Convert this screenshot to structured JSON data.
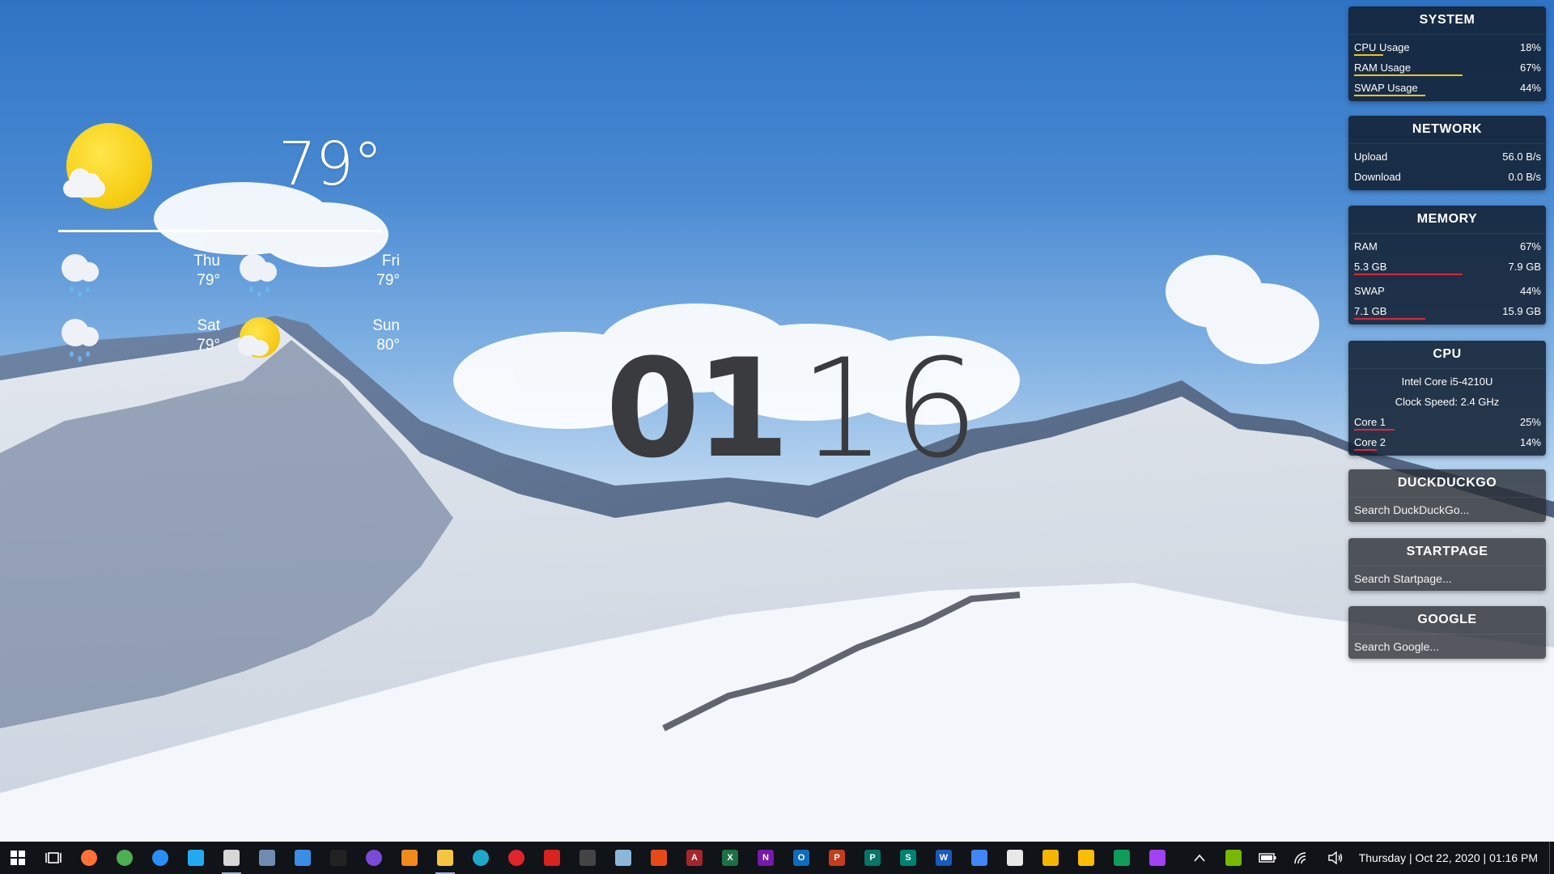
{
  "weather": {
    "current_temp": "79°",
    "current_icon": "sun-cloud-icon",
    "forecast": [
      {
        "day": "Thu",
        "temp": "79°",
        "icon": "rain-cloud-icon"
      },
      {
        "day": "Fri",
        "temp": "79°",
        "icon": "rain-cloud-icon"
      },
      {
        "day": "Sat",
        "temp": "79°",
        "icon": "rain-cloud-icon"
      },
      {
        "day": "Sun",
        "temp": "80°",
        "icon": "sun-cloud-icon"
      }
    ]
  },
  "clock": {
    "hours": "01",
    "minutes": "16"
  },
  "system": {
    "title": "SYSTEM",
    "rows": [
      {
        "label": "CPU Usage",
        "value": "18%",
        "level": 0.18
      },
      {
        "label": "RAM Usage",
        "value": "67%",
        "level": 0.67
      },
      {
        "label": "SWAP Usage",
        "value": "44%",
        "level": 0.44
      }
    ],
    "bar_color": "#f0c419"
  },
  "network": {
    "title": "NETWORK",
    "rows": [
      {
        "label": "Upload",
        "value": "56.0 B/s"
      },
      {
        "label": "Download",
        "value": "0.0 B/s"
      }
    ]
  },
  "memory": {
    "title": "MEMORY",
    "ram_label": "RAM",
    "ram_percent": "67%",
    "ram_used": "5.3 GB",
    "ram_total": "7.9 GB",
    "ram_level": 0.67,
    "swap_label": "SWAP",
    "swap_percent": "44%",
    "swap_used": "7.1 GB",
    "swap_total": "15.9 GB",
    "swap_level": 0.44,
    "bar_color": "#d8293a"
  },
  "cpu": {
    "title": "CPU",
    "model": "Intel Core i5-4210U",
    "clock_speed": "Clock Speed: 2.4 GHz",
    "cores": [
      {
        "label": "Core 1",
        "value": "25%",
        "level": 0.25
      },
      {
        "label": "Core 2",
        "value": "14%",
        "level": 0.14
      }
    ],
    "bar_color": "#d8293a"
  },
  "search": [
    {
      "title": "DUCKDUCKGO",
      "placeholder": "Search DuckDuckGo..."
    },
    {
      "title": "STARTPAGE",
      "placeholder": "Search Startpage..."
    },
    {
      "title": "GOOGLE",
      "placeholder": "Search Google..."
    }
  ],
  "taskbar": {
    "apps": [
      {
        "name": "firefox-icon",
        "glyph": "",
        "color": "#ff7139"
      },
      {
        "name": "chrome-icon",
        "glyph": "",
        "color": "#4caf50"
      },
      {
        "name": "firefox-dev-icon",
        "glyph": "",
        "color": "#2a8ef5"
      },
      {
        "name": "vscode-icon",
        "glyph": "",
        "color": "#23a9f2"
      },
      {
        "name": "notepad-icon",
        "glyph": "",
        "color": "#d7d7d7"
      },
      {
        "name": "calculator-icon",
        "glyph": "",
        "color": "#6f8bb0"
      },
      {
        "name": "remote-desktop-icon",
        "glyph": "",
        "color": "#3a8ee6"
      },
      {
        "name": "terminal-icon",
        "glyph": "",
        "color": "#222"
      },
      {
        "name": "tor-icon",
        "glyph": "",
        "color": "#7b4ad6"
      },
      {
        "name": "vlc-icon",
        "glyph": "",
        "color": "#f08a1c"
      },
      {
        "name": "file-explorer-icon",
        "glyph": "",
        "color": "#f5c542"
      },
      {
        "name": "edge-icon",
        "glyph": "",
        "color": "#1fa7c9"
      },
      {
        "name": "opera-icon",
        "glyph": "",
        "color": "#e0242b"
      },
      {
        "name": "acrobat-icon",
        "glyph": "",
        "color": "#d8231f"
      },
      {
        "name": "game-controller-icon",
        "glyph": "",
        "color": "#444"
      },
      {
        "name": "settings-app-icon",
        "glyph": "",
        "color": "#8db7d9"
      },
      {
        "name": "office-icon",
        "glyph": "",
        "color": "#e64a19"
      },
      {
        "name": "access-icon",
        "glyph": "A",
        "color": "#a4262c"
      },
      {
        "name": "excel-icon",
        "glyph": "X",
        "color": "#1d7044"
      },
      {
        "name": "onenote-icon",
        "glyph": "N",
        "color": "#7719aa"
      },
      {
        "name": "outlook-icon",
        "glyph": "O",
        "color": "#0f6cbd"
      },
      {
        "name": "powerpoint-icon",
        "glyph": "P",
        "color": "#c43e1c"
      },
      {
        "name": "publisher-icon",
        "glyph": "P",
        "color": "#077568"
      },
      {
        "name": "sway-icon",
        "glyph": "S",
        "color": "#008272"
      },
      {
        "name": "word-icon",
        "glyph": "W",
        "color": "#185abd"
      },
      {
        "name": "docs-icon",
        "glyph": "",
        "color": "#4285f4"
      },
      {
        "name": "file-icon",
        "glyph": "",
        "color": "#e8e8e8"
      },
      {
        "name": "slides-icon",
        "glyph": "",
        "color": "#f4b400"
      },
      {
        "name": "keep-icon",
        "glyph": "",
        "color": "#fbbc04"
      },
      {
        "name": "sheets-icon",
        "glyph": "",
        "color": "#0f9d58"
      },
      {
        "name": "forms-icon",
        "glyph": "",
        "color": "#a142f4"
      }
    ],
    "datetime": "Thursday | Oct 22, 2020 | 01:16 PM"
  }
}
